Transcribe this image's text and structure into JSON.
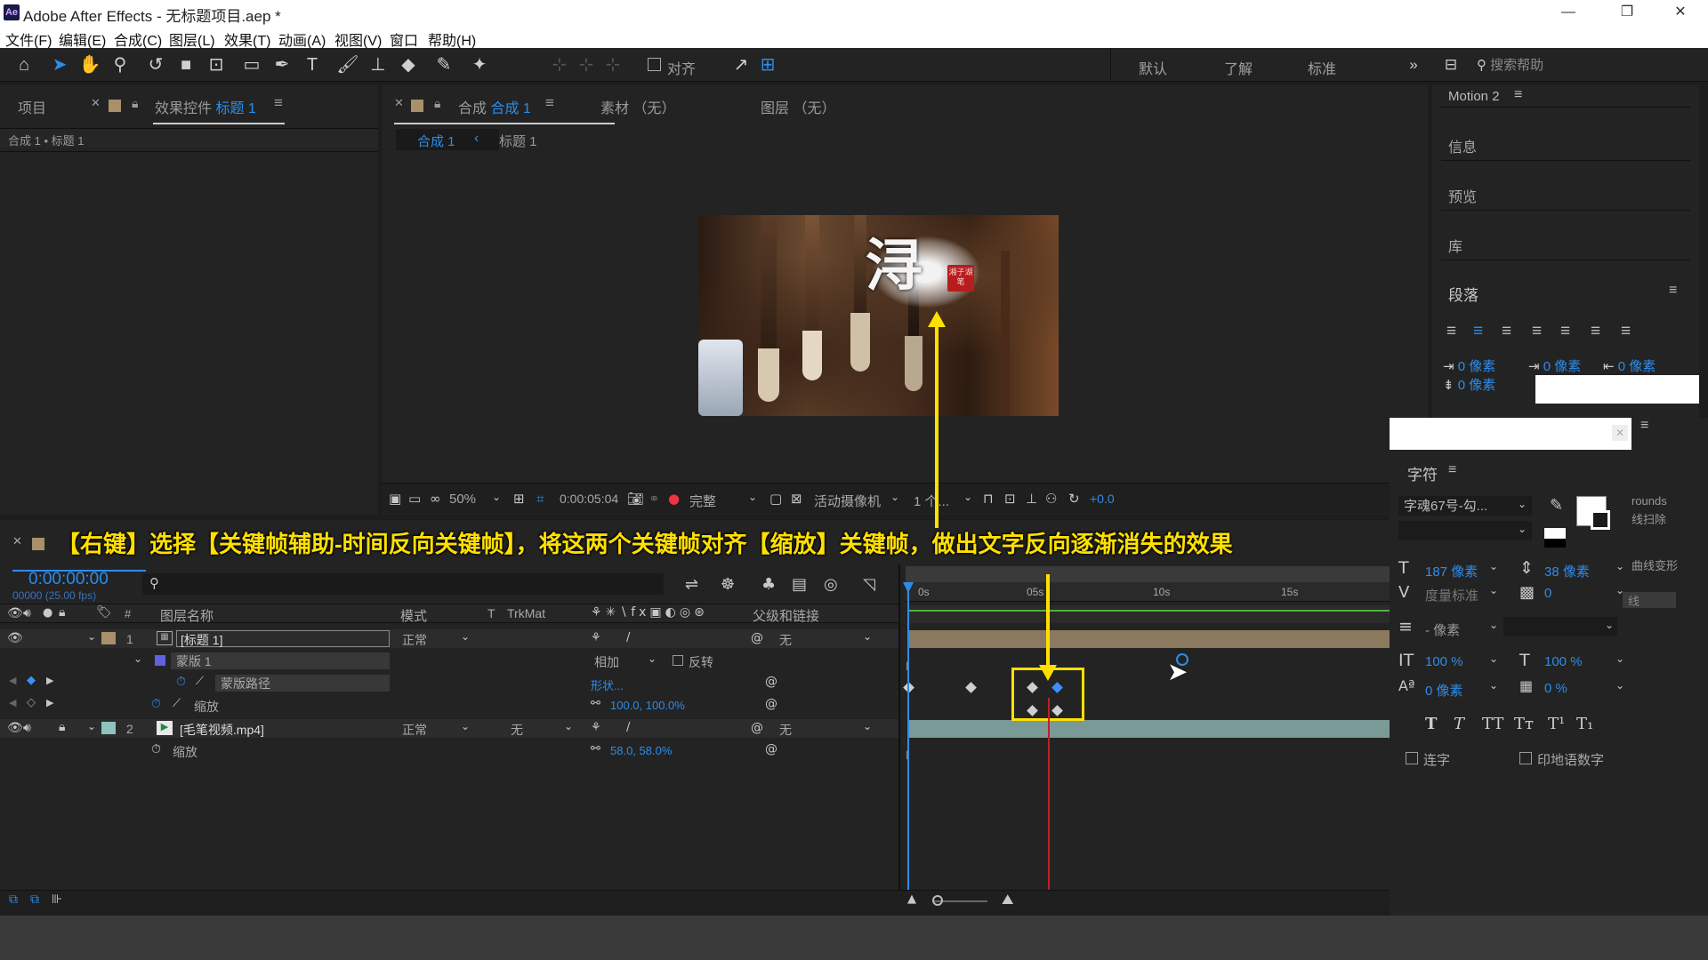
{
  "titlebar": {
    "title": "Adobe After Effects - 无标题项目.aep *",
    "logo": "Ae"
  },
  "menu": [
    "文件(F)",
    "编辑(E)",
    "合成(C)",
    "图层(L)",
    "效果(T)",
    "动画(A)",
    "视图(V)",
    "窗口",
    "帮助(H)"
  ],
  "toolbar": {
    "align_label": "对齐",
    "workspaces": [
      "默认",
      "了解",
      "标准"
    ],
    "search_placeholder": "搜索帮助"
  },
  "project_panel": {
    "tab_project": "项目",
    "tab_effects_prefix": "效果控件",
    "tab_effects_layer": "标题 1",
    "breadcrumb": "合成 1 • 标题 1"
  },
  "comp_panel": {
    "tab_prefix": "合成",
    "tab_name": "合成 1",
    "tab_footage": "素材 （无）",
    "tab_layer": "图层 （无）",
    "crumb_active": "合成 1",
    "crumb_next": "标题 1",
    "zoom": "50%",
    "timecode": "0:00:05:04",
    "resolution": "完整",
    "camera": "活动摄像机",
    "views": "1 个...",
    "exposure": "+0.0"
  },
  "preview": {
    "calligraphy_char": "浔",
    "seal_text": "湘子湖笔"
  },
  "overlay_caption": "【右键】选择【关键帧辅助-时间反向关键帧】，将这两个关键帧对齐【缩放】关键帧，做出文字反向逐渐消失的效果",
  "timeline": {
    "timecode": "0:00:00:00",
    "fps": "00000 (25.00 fps)",
    "search_placeholder": "",
    "columns": {
      "layer_name": "图层名称",
      "mode": "模式",
      "t": "T",
      "trkmat": "TrkMat",
      "parent": "父级和链接"
    },
    "ruler": [
      "0s",
      "05s",
      "10s",
      "15s"
    ],
    "layers": [
      {
        "index": "1",
        "name": "[标题 1]",
        "mode": "正常",
        "parent": "无"
      },
      {
        "index": "2",
        "name": "[毛笔视频.mp4]",
        "mode": "正常",
        "trkmat": "无",
        "parent": "无"
      }
    ],
    "mask": {
      "name": "蒙版 1",
      "mode": "相加",
      "invert": "反转"
    },
    "mask_path": {
      "name": "蒙版路径",
      "value": "形状..."
    },
    "scale1": {
      "name": "缩放",
      "value": "100.0, 100.0%"
    },
    "scale2": {
      "name": "缩放",
      "value": "58.0, 58.0%"
    }
  },
  "right_panel": {
    "workspace": "Motion 2",
    "items": [
      "信息",
      "预览",
      "库"
    ],
    "paragraph": "段落",
    "indent_values": [
      "0 像素",
      "0 像素",
      "0 像素",
      "0 像素"
    ],
    "character": "字符",
    "font": "字魂67号-勾...",
    "font_size": "187 像素",
    "leading": "38 像素",
    "kerning": "度量标准",
    "tracking": "0",
    "stroke": "- 像素",
    "vscale": "100 %",
    "hscale": "100 %",
    "baseline": "0 像素",
    "tsume": "0 %",
    "ligature": "连字",
    "hindi": "印地语数字",
    "bg_text1": "rounds",
    "bg_text2": "线扫除",
    "bg_text3": "曲线变形",
    "bg_text4": "线"
  },
  "colors": {
    "accent": "#2d8ceb",
    "annotation": "#ffe000",
    "playhead": "#e02020",
    "panel": "#232323"
  }
}
